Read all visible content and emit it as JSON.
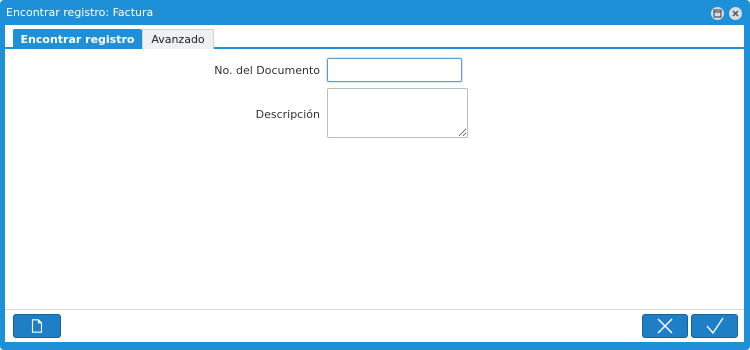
{
  "window": {
    "title": "Encontrar registro: Factura",
    "controls": [
      "maximize-icon",
      "close-icon"
    ]
  },
  "tabs": [
    {
      "label": "Encontrar registro",
      "active": true
    },
    {
      "label": "Avanzado",
      "active": false
    }
  ],
  "form": {
    "document_number": {
      "label": "No. del Documento",
      "value": ""
    },
    "description": {
      "label": "Descripción",
      "value": ""
    }
  },
  "footer": {
    "buttons": [
      {
        "name": "new-record",
        "icon": "document-icon"
      },
      {
        "name": "cancel",
        "icon": "x-icon"
      },
      {
        "name": "ok",
        "icon": "checkmark-icon"
      }
    ]
  },
  "colors": {
    "accent": "#1e90d8",
    "button": "#1e7fc6"
  }
}
